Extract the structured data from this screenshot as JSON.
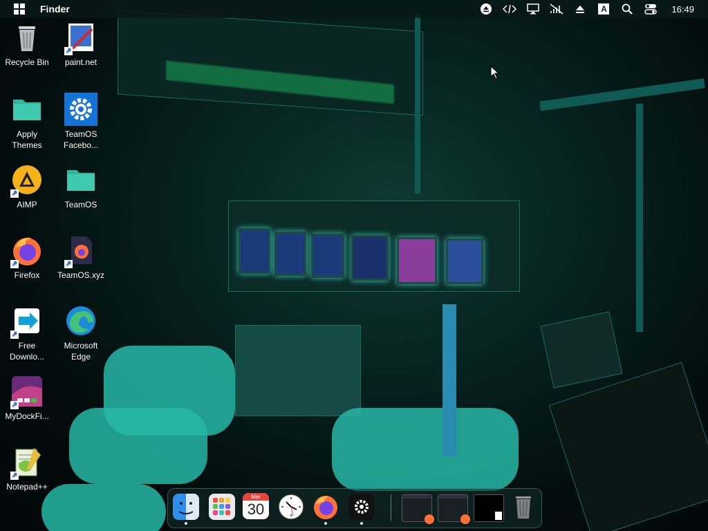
{
  "topbar": {
    "app_name": "Finder",
    "time": "16:49",
    "icons": [
      "windows-logo-icon",
      "eject-icon",
      "code-icon",
      "display-icon",
      "mute-icon",
      "upload-icon",
      "keyboard-layout-icon",
      "search-icon",
      "control-center-icon"
    ],
    "keyboard_letter": "A"
  },
  "desktop_icons": [
    {
      "id": "recycle-bin",
      "label": "Recycle Bin"
    },
    {
      "id": "paint-net",
      "label": "paint.net"
    },
    {
      "id": "apply-themes",
      "label": "Apply Themes"
    },
    {
      "id": "teamos-facebook",
      "label": "TeamOS Facebo..."
    },
    {
      "id": "aimp",
      "label": "AIMP"
    },
    {
      "id": "teamos",
      "label": "TeamOS"
    },
    {
      "id": "firefox",
      "label": "Firefox"
    },
    {
      "id": "teamos-xyz",
      "label": "TeamOS.xyz"
    },
    {
      "id": "free-download",
      "label": "Free Downlo..."
    },
    {
      "id": "microsoft-edge",
      "label": "Microsoft Edge"
    },
    {
      "id": "mydockfinder",
      "label": "MyDockFi..."
    },
    {
      "id": "notepad-plus-plus",
      "label": "Notepad++"
    }
  ],
  "dock": {
    "calendar_month": "Mar",
    "calendar_day": "30",
    "items": [
      "finder-icon",
      "launchpad-icon",
      "calendar-icon",
      "clock-icon",
      "firefox-icon",
      "settings-icon"
    ],
    "thumbnails": [
      "window-thumbnail-1",
      "window-thumbnail-2",
      "window-thumbnail-3"
    ],
    "trash": "trash-icon"
  },
  "colors": {
    "accent": "#2ec4b0",
    "topbar_bg": "#08191699"
  }
}
